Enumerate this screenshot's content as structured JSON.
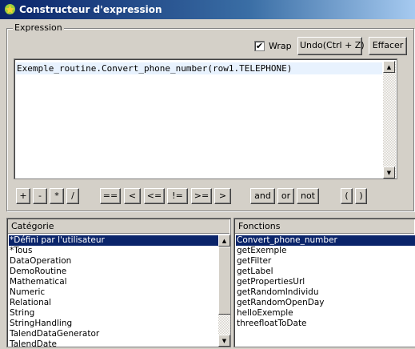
{
  "window": {
    "title": "Constructeur d'expression"
  },
  "expression": {
    "group_label": "Expression",
    "wrap_label": "Wrap",
    "wrap_checked": true,
    "wrap_check_glyph": "✔",
    "undo_label": "Undo(Ctrl + Z)",
    "clear_label": "Effacer",
    "text": "Exemple_routine.Convert_phone_number(row1.TELEPHONE)"
  },
  "operators": {
    "plus": "+",
    "minus": "-",
    "times": "*",
    "divide": "/",
    "eq": "==",
    "lt": "<",
    "le": "<=",
    "ne": "!=",
    "ge": ">=",
    "gt": ">",
    "and": "and",
    "or": "or",
    "not": "not",
    "lparen": "(",
    "rparen": ")"
  },
  "categories": {
    "header": "Catégorie",
    "selected_index": 0,
    "items": [
      "*Défini par l'utilisateur",
      "*Tous",
      "DataOperation",
      "DemoRoutine",
      "Mathematical",
      "Numeric",
      "Relational",
      "String",
      "StringHandling",
      "TalendDataGenerator",
      "TalendDate"
    ]
  },
  "functions": {
    "header": "Fonctions",
    "selected_index": 0,
    "items": [
      "Convert_phone_number",
      "getExemple",
      "getFilter",
      "getLabel",
      "getPropertiesUrl",
      "getRandomIndividu",
      "getRandomOpenDay",
      "helloExemple",
      "threefloatToDate"
    ]
  },
  "colors": {
    "selection": "#0a246a",
    "title_start": "#0a246a",
    "title_end": "#a6caf0"
  }
}
